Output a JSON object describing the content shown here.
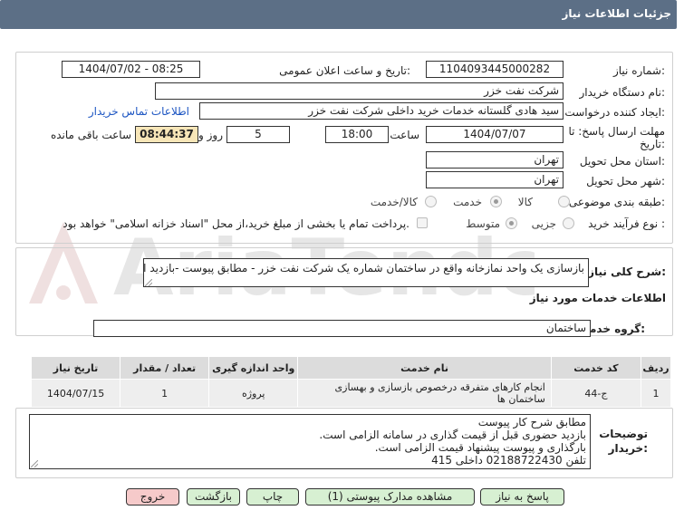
{
  "header": {
    "title": "جزئیات اطلاعات نیاز"
  },
  "form": {
    "need_number_label": "شماره نیاز:",
    "need_number": "1104093445000282",
    "announce_label": "تاریخ و ساعت اعلان عمومی:",
    "announce_value": "1404/07/02 - 08:25",
    "buyer_label": "نام دستگاه خریدار:",
    "buyer": "شرکت نفت خزر",
    "creator_label": "ایجاد کننده درخواست:",
    "creator": "سید هادی گلستانه خدمات خرید داخلی شرکت نفت خزر",
    "contact_link": "اطلاعات تماس خریدار",
    "deadline_label_1": "مهلت ارسال پاسخ: تا",
    "deadline_label_2": "تاریخ:",
    "deadline_date": "1404/07/07",
    "time_label": "ساعت",
    "deadline_time": "18:00",
    "days_value": "5",
    "days_label": "روز و",
    "remaining_time": "08:44:37",
    "remaining_label": "ساعت باقی مانده",
    "province_label": "استان محل تحویل:",
    "province": "تهران",
    "city_label": "شهر محل تحویل:",
    "city": "تهران",
    "category_label": "طبقه بندی موضوعی:",
    "category_options": [
      "کالا",
      "خدمت",
      "کالا/خدمت"
    ],
    "category_selected": "خدمت",
    "process_label": "نوع فرآیند خرید :",
    "process_options": [
      "جزیی",
      "متوسط"
    ],
    "process_selected": "متوسط",
    "payment_note": "پرداخت تمام یا بخشی از مبلغ خرید،از محل \"اسناد خزانه اسلامی\" خواهد بود."
  },
  "summary": {
    "label": "شرح کلی نیاز:",
    "text": "بازسازی یک واحد نمازخانه واقع در ساختمان شماره یک شرکت نفت خزر - مطابق پیوست -بازدید الزامیست"
  },
  "services": {
    "section_title": "اطلاعات خدمات مورد نیاز",
    "group_label": "گروه خدمت:",
    "group_value": "ساختمان",
    "columns": [
      "ردیف",
      "کد خدمت",
      "نام خدمت",
      "واحد اندازه گیری",
      "تعداد / مقدار",
      "تاریخ نیاز"
    ],
    "rows": [
      {
        "index": "1",
        "code": "ج-44",
        "name": "انجام کارهای متفرقه درخصوص بازسازی و بهسازی ساختمان ها",
        "unit": "پروژه",
        "qty": "1",
        "date": "1404/07/15"
      }
    ]
  },
  "notes": {
    "label_1": "توضیحات",
    "label_2": "خریدار:",
    "lines": [
      "مطابق شرح کار پیوست",
      "بازدید حضوری قبل از قیمت گذاری در سامانه الزامی است.",
      "بارگذاری و پیوست پیشنهاد قیمت الزامی است.",
      "تلفن 02188722430 داخلی 415"
    ]
  },
  "buttons": {
    "reply": "پاسخ به نیاز",
    "attachments": "مشاهده مدارک پیوستی (1)",
    "print": "چاپ",
    "back": "بازگشت",
    "exit": "خروج"
  },
  "colors": {
    "header_bg": "#5c6f86",
    "button_green": "#d7f0d2",
    "button_red": "#f6caca",
    "link": "#1c55c2"
  }
}
